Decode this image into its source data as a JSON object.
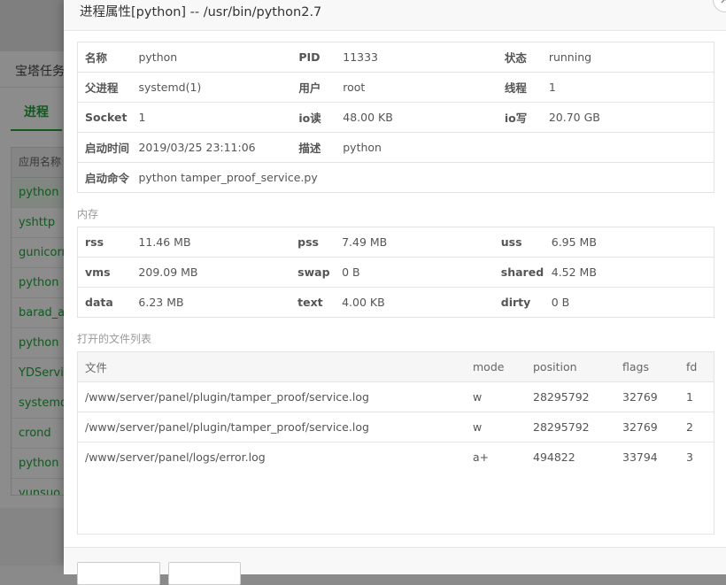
{
  "background": {
    "card_title": "宝塔任务",
    "tab_label": "进程",
    "list_header": "应用名称",
    "list_items": [
      "python",
      "yshttp",
      "gunicorn",
      "python",
      "barad_ag",
      "python",
      "YDService",
      "systemd",
      "crond",
      "python",
      "yunsuo_a"
    ]
  },
  "dialog": {
    "title": "进程属性[python] -- /usr/bin/python2.7",
    "close_symbol": "×",
    "info": {
      "name_label": "名称",
      "name_value": "python",
      "pid_label": "PID",
      "pid_value": "11333",
      "status_label": "状态",
      "status_value": "running",
      "parent_label": "父进程",
      "parent_value": "systemd(1)",
      "user_label": "用户",
      "user_value": "root",
      "threads_label": "线程",
      "threads_value": "1",
      "socket_label": "Socket",
      "socket_value": "1",
      "ioread_label": "io读",
      "ioread_value": "48.00 KB",
      "iowrite_label": "io写",
      "iowrite_value": "20.70 GB",
      "start_label": "启动时间",
      "start_value": "2019/03/25 23:11:06",
      "desc_label": "描述",
      "desc_value": "python",
      "cmd_label": "启动命令",
      "cmd_value": "python tamper_proof_service.py"
    },
    "memory_section": "内存",
    "memory": {
      "rss_label": "rss",
      "rss_value": "11.46 MB",
      "pss_label": "pss",
      "pss_value": "7.49 MB",
      "uss_label": "uss",
      "uss_value": "6.95 MB",
      "vms_label": "vms",
      "vms_value": "209.09 MB",
      "swap_label": "swap",
      "swap_value": "0 B",
      "shared_label": "shared",
      "shared_value": "4.52 MB",
      "data_label": "data",
      "data_value": "6.23 MB",
      "text_label": "text",
      "text_value": "4.00 KB",
      "dirty_label": "dirty",
      "dirty_value": "0 B"
    },
    "files_section": "打开的文件列表",
    "files_headers": {
      "file": "文件",
      "mode": "mode",
      "position": "position",
      "flags": "flags",
      "fd": "fd"
    },
    "files": [
      {
        "file": "/www/server/panel/plugin/tamper_proof/service.log",
        "mode": "w",
        "position": "28295792",
        "flags": "32769",
        "fd": "1"
      },
      {
        "file": "/www/server/panel/plugin/tamper_proof/service.log",
        "mode": "w",
        "position": "28295792",
        "flags": "32769",
        "fd": "2"
      },
      {
        "file": "/www/server/panel/logs/error.log",
        "mode": "a+",
        "position": "494822",
        "flags": "33794",
        "fd": "3"
      }
    ],
    "footer_buttons": [
      "",
      ""
    ]
  }
}
